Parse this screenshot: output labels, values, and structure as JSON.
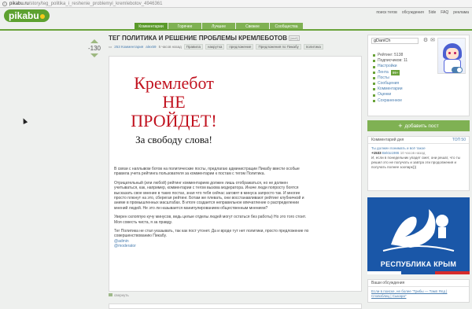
{
  "browser": {
    "url_host": "pikabu.ru",
    "url_path": "/story/teg_politika_i_reshenie_problemyi_kremlebotov_4946361"
  },
  "header": {
    "logo": "pikabu",
    "top_links": [
      "поиск тегов",
      "обсуждения",
      "5ide",
      "FAQ",
      "реклама"
    ],
    "tabs": [
      "Комментарии",
      "Горячее",
      "Лучшее",
      "Свежее",
      "Сообщества"
    ],
    "active_tab": 0
  },
  "post": {
    "score": "-130",
    "title": "ТЕГ ПОЛИТИКА И РЕШЕНИЕ ПРОБЛЕМЫ КРЕМЛЕБОТОВ",
    "edit_badge": "[моё]",
    "comments": "253 Комментария",
    "author": "alex59",
    "time": "5 часов назад",
    "tags": [
      "Правила",
      "накрутка",
      "предложение",
      "Предложения по Пикабу",
      "политика"
    ],
    "poster": {
      "line1": "Кремлебот",
      "line2": "НЕ",
      "line3": "ПРОЙДЕТ!",
      "line4": "За свободу слова!"
    },
    "paragraphs": [
      "В связи с наплывом ботов на политические посты, предлагаю администрации Пикабу ввести особые правила учета рейтинга пользователя за комментарии к постам с тегом Политика.",
      "Отрицательный (или любой) рейтинг комментариев должен лишь отображаться, но не должен учитываться, как, например, комментарии с тегом вызова модератора.\nИначе люди попросту боятся высказать свое мнение в таких постах, зная что тебя сейчас заговят в минуса запросто так.\nИ многие просто плюнут на это, сберегая рейтинг. Ботам же плевать, они восстанавливают рейтинг клубничкой и аниме в промышленных масштабах. В итоге создается неправильное впечатление о распределении мнений людей. Не это ли называется манипулированием общественным мнением?",
      "Уверен склоппую кучу минусов, ведь целые отделы людей могут остаться без работы) Но это того стоит. Моя совесть чиста, я за правду.",
      "Тег Политика не стал указывать, так как пост утонет. Да и вроде тут нет политики, просто предложение по совершенствованию Пикабу."
    ],
    "mentions": [
      "@admin",
      "@moderator"
    ],
    "share": "свернуть"
  },
  "sidebar": {
    "username": "gDaniCh",
    "stats": [
      {
        "label": "Рейтинг: 5138",
        "link": false
      },
      {
        "label": "Подписчиков: 11",
        "link": false
      },
      {
        "label": "Настройки",
        "link": true
      },
      {
        "label": "Лента",
        "link": true,
        "badge": "99+"
      },
      {
        "label": "Посты",
        "link": true
      },
      {
        "label": "Сообщения",
        "link": true
      },
      {
        "label": "Комментарии",
        "link": true
      },
      {
        "label": "Оценки",
        "link": true
      },
      {
        "label": "Сохраненное",
        "link": true
      }
    ],
    "add_post": "добавить пост",
    "comments_block": {
      "title": "Комментарий дня",
      "top": "ТОП 50",
      "question": "Ты должен понимать и всё такое",
      "count": "+1533",
      "author": "Bekto1986",
      "time": "10 часов назад",
      "text": "И, если в понедельник упадет смет, они решат, что ты решил это не получать и завтра эти продолжения и получать полнее зоопарк)))"
    },
    "banner": "РЕСПУБЛИКА КРЫМ",
    "discussion": {
      "title": "Ваши обсуждения",
      "text": "Если в поиске, не более \"Грибы — Тамп Ялд | Сповоблиц | Сыкара\""
    }
  },
  "colors": {
    "brand_green": "#6aa33a",
    "tab_green": "#7fb153",
    "link_blue": "#4a7eb0",
    "poster_red": "#c1121f",
    "banner_blue": "#1a57a8"
  }
}
